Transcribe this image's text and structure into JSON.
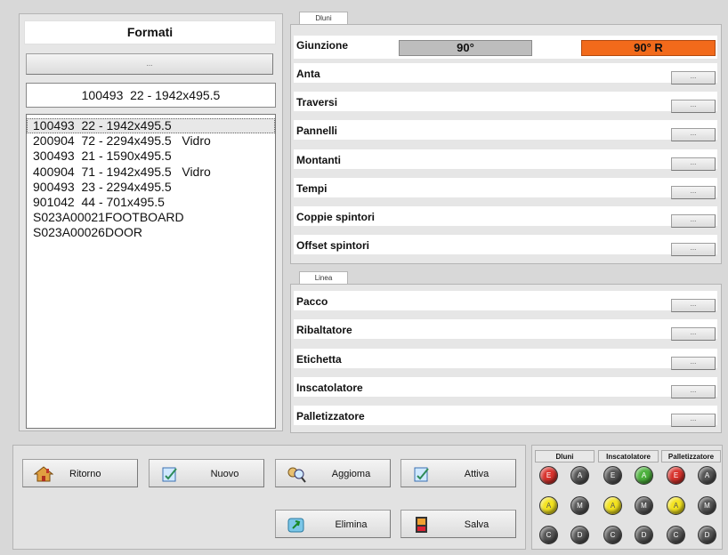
{
  "formats": {
    "title": "Formati",
    "top_button_label": "...",
    "selected_value": "100493  22 - 1942x495.5",
    "items": [
      "100493  22 - 1942x495.5",
      "200904  72 - 2294x495.5   Vidro",
      "300493  21 - 1590x495.5",
      "400904  71 - 1942x495.5   Vidro",
      "900493  23 - 2294x495.5",
      "901042  44 - 701x495.5",
      "S023A00021FOOTBOARD",
      "S023A00026DOOR"
    ]
  },
  "dluni": {
    "group_label": "Dluni",
    "giunzione": {
      "label": "Giunzione",
      "value_left": "90°",
      "value_right": "90° R",
      "accent_color": "#f26a1b"
    },
    "rows": [
      {
        "label": "Anta",
        "button": "..."
      },
      {
        "label": "Traversi",
        "button": "..."
      },
      {
        "label": "Pannelli",
        "button": "..."
      },
      {
        "label": "Montanti",
        "button": "..."
      },
      {
        "label": "Tempi",
        "button": "..."
      },
      {
        "label": "Coppie spintori",
        "button": "..."
      },
      {
        "label": "Offset spintori",
        "button": "..."
      }
    ]
  },
  "linea": {
    "group_label": "Linea",
    "rows": [
      {
        "label": "Pacco",
        "button": "..."
      },
      {
        "label": "Ribaltatore",
        "button": "..."
      },
      {
        "label": "Etichetta",
        "button": "..."
      },
      {
        "label": "Inscatolatore",
        "button": "..."
      },
      {
        "label": "Palletizzatore",
        "button": "..."
      }
    ]
  },
  "toolbar": {
    "ritorno": "Ritorno",
    "nuovo": "Nuovo",
    "aggiorna": "Aggioma",
    "attiva": "Attiva",
    "elimina": "Elimina",
    "salva": "Salva"
  },
  "status": {
    "headers": [
      "Dluni",
      "Inscatolatore",
      "Palletizzatore"
    ],
    "lamps": [
      [
        "E",
        "A",
        "E",
        "A",
        "E",
        "A"
      ],
      [
        "A",
        "M",
        "A",
        "M",
        "A",
        "M"
      ],
      [
        "C",
        "D",
        "C",
        "D",
        "C",
        "D"
      ]
    ],
    "lamp_colors": [
      [
        "red",
        "gray",
        "gray",
        "green",
        "red",
        "gray"
      ],
      [
        "yellow",
        "gray",
        "yellow",
        "gray",
        "yellow",
        "gray"
      ],
      [
        "gray",
        "gray",
        "gray",
        "gray",
        "gray",
        "gray"
      ]
    ]
  }
}
